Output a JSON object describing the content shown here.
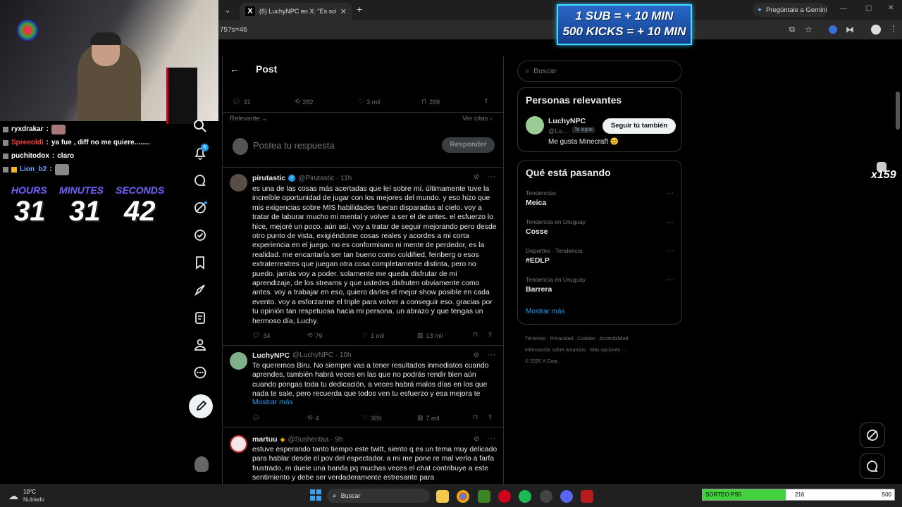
{
  "browser": {
    "tab_title": "(6) LuchyNPC en X: \"Es solo mi",
    "url_fragment": "75?s=46",
    "gemini_button": "Pregúntale a Gemini"
  },
  "banner": {
    "line1": "1 SUB = + 10 MIN",
    "line2": "500 KICKS = + 10 MIN"
  },
  "stream": {
    "chat": [
      {
        "user": "ryxdrakar",
        "message": "",
        "color": "#e6e6e6"
      },
      {
        "user": "Spreeoldi",
        "message": "ya fue , diff no me quiere........",
        "color": "#ff3b3b"
      },
      {
        "user": "puchitodox",
        "message": "claro",
        "color": "#e6e6e6"
      },
      {
        "user": "Lion_b2",
        "message": "",
        "color": "#6fa8ff"
      }
    ],
    "timer": {
      "hours_label": "HOURS",
      "minutes_label": "MINUTES",
      "seconds_label": "SECONDS",
      "hours": "31",
      "minutes": "31",
      "seconds": "42"
    },
    "side_counter": "x159"
  },
  "nav": {
    "notification_count": "6"
  },
  "post": {
    "header": "Post",
    "stats": {
      "replies": "31",
      "reposts": "282",
      "likes": "3 mil",
      "bookmarks": "289"
    },
    "sort_label": "Relevante",
    "quotes_link": "Ver citas",
    "reply_placeholder": "Postea tu respuesta",
    "reply_button": "Responder"
  },
  "replies": [
    {
      "name": "pirutastic",
      "handle": "@Pirutastic · 11h",
      "text": "es una de las cosas más acertadas que leí sobre mí. últimamente tuve la increíble oportunidad de jugar con los mejores del mundo. y eso hizo que mis exigencias sobre MIS habilidades fueran disparadas al cielo. voy a tratar de laburar mucho mi mental y volver a ser el de antes. el esfuerzo lo hice, mejoré un poco. aún así, voy a tratar de seguir mejorando pero desde otro punto de vista, exigiéndome cosas reales y acordes a mi corta experiencia en el juego. no es conformismo ni mente de perdedor, es la realidad. me encantaría ser tan bueno como coldified, feinberg o esos extraterrestres que juegan otra cosa completamente distinta, pero no puedo. jamás voy a poder. solamente me queda disfrutar de mi aprendizaje, de los streams y que ustedes disfruten obviamente como antes. voy a trabajar en eso, quiero darles el mejor show posible en cada evento. voy a esforzarme el triple para volver a conseguir eso. gracias por tu opinión tan respetuosa hacia mi persona. un abrazo y que tengas un hermoso día, Luchy.",
      "replies": "34",
      "reposts": "79",
      "likes": "1 mil",
      "views": "13 mil"
    },
    {
      "name": "LuchyNPC",
      "handle": "@LuchyNPC · 10h",
      "text": "Te queremos Biru. No siempre vas a tener resultados inmediatos cuando aprendes, también habrá veces en las que no podrás rendir bien aún cuando pongas toda tu dedicación, a veces habrá malos días en los que nada te sale, pero recuerda que todos ven tu esfuerzo y esa mejora te",
      "show_more": "Mostrar más",
      "replies": "",
      "reposts": "4",
      "likes": "309",
      "views": "7 mil"
    },
    {
      "name": "martuu",
      "handle": "@Susheritaa · 9h",
      "text": "estuve esperando tanto tiempo este twitt, siento q es un tema muy delicado para hablar desde el pov del espectador. a mi me pone re mal verlo a farfa frustrado, m duele una banda pq muchas veces el chat contribuye a este sentimiento y debe ser verdaderamente estresante para"
    }
  ],
  "sidebar": {
    "search_placeholder": "Buscar",
    "relevant_title": "Personas relevantes",
    "person": {
      "name": "LuchyNPC",
      "handle": "@Lu...",
      "follows_badge": "Te sigue",
      "follow_button": "Seguir tú también",
      "bio": "Me gusta Minecraft 😊"
    },
    "trends_title": "Qué está pasando",
    "trends": [
      {
        "category": "Tendencias",
        "name": "Meica"
      },
      {
        "category": "Tendencia en Uruguay",
        "name": "Cosse"
      },
      {
        "category": "Deportes · Tendencia",
        "name": "#EDLP"
      },
      {
        "category": "Tendencia en Uruguay",
        "name": "Barrera"
      }
    ],
    "show_more": "Mostrar más",
    "footer": [
      "Términos",
      "Privacidad",
      "Cookies",
      "Accesibilidad",
      "Información sobre anuncios",
      "Más opciones ···",
      "© 2026 X Corp."
    ]
  },
  "taskbar": {
    "temp": "10°C",
    "weather": "Nublado",
    "search": "Buscar",
    "goal_label": "SORTEO PS5",
    "goal_current": "216",
    "goal_target": "500",
    "goal_progress": 0.432
  },
  "colors": {
    "accent": "#1d9bf0",
    "border": "#2f3336",
    "muted": "#71767b"
  }
}
